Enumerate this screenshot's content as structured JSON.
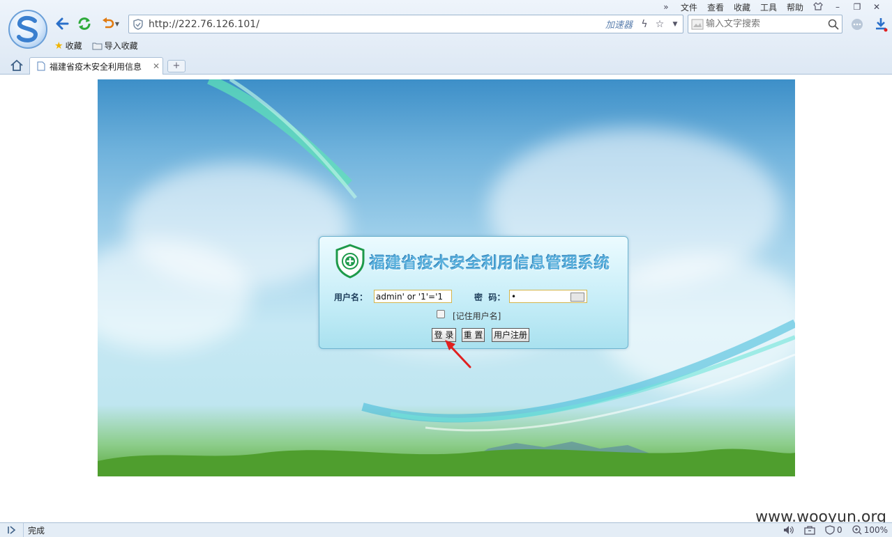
{
  "browser": {
    "menu": [
      "文件",
      "查看",
      "收藏",
      "工具",
      "帮助"
    ],
    "address_url": "http://222.76.126.101/",
    "accelerator_label": "加速器",
    "search_placeholder": "输入文字搜索",
    "favorites_bar": [
      "收藏",
      "导入收藏"
    ],
    "tab_title": "福建省疫木安全利用信息",
    "new_tab_label": "+",
    "status_text": "完成",
    "status_count": "0",
    "zoom_level": "100%",
    "watermark": "www.wooyun.org"
  },
  "login": {
    "system_title": "福建省疫木安全利用信息管理系统",
    "username_label": "用户名：",
    "username_value": "admin' or '1'='1",
    "password_label": "密  码：",
    "password_value": "•",
    "remember_label": "[记住用户名]",
    "login_button": "登 录",
    "reset_button": "重 置",
    "register_button": "用户注册"
  },
  "colors": {
    "title_blue": "#5ab0dc",
    "annotation_arrow": "#e02020",
    "emblem_green": "#1e9a4a"
  },
  "icons": [
    "back-icon",
    "refresh-icon",
    "undo-icon",
    "shield-icon",
    "lightning-icon",
    "star-icon",
    "search-icon",
    "download-icon",
    "home-icon",
    "page-icon",
    "folder-icon",
    "speaker-icon",
    "zoom-icon"
  ]
}
